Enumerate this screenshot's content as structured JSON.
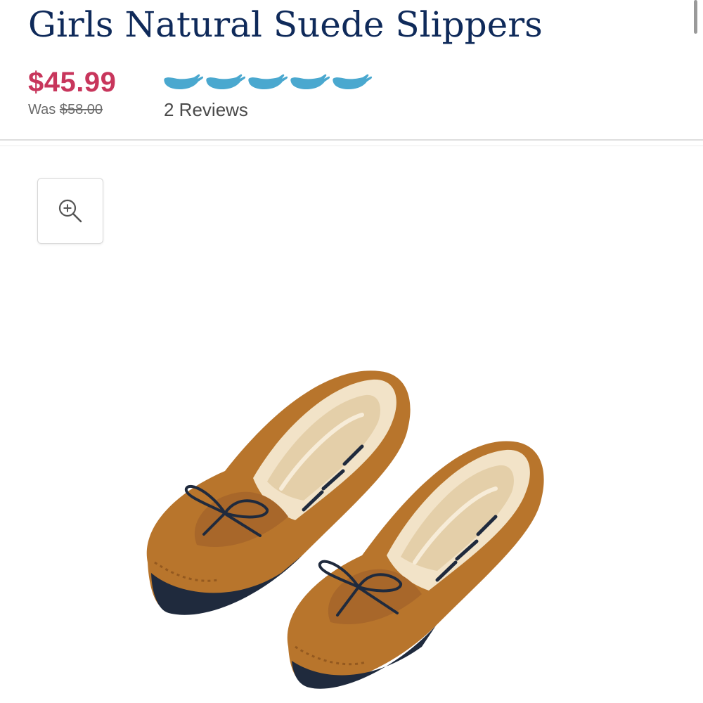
{
  "product": {
    "title": "Girls Natural Suede Slippers",
    "price": "$45.99",
    "was_label": "Was",
    "was_price": "$58.00",
    "rating": {
      "value": 5,
      "max": 5,
      "icon": "whale-icon",
      "color": "#4aa8cf",
      "reviews_label": "2 Reviews"
    }
  },
  "gallery": {
    "zoom_icon": "zoom-in-icon",
    "image_subject": "tan suede moccasin slippers with shearling lining and navy laces"
  },
  "colors": {
    "title": "#0f2a5a",
    "sale_price": "#c8365c",
    "muted_text": "#6b6b6b"
  }
}
